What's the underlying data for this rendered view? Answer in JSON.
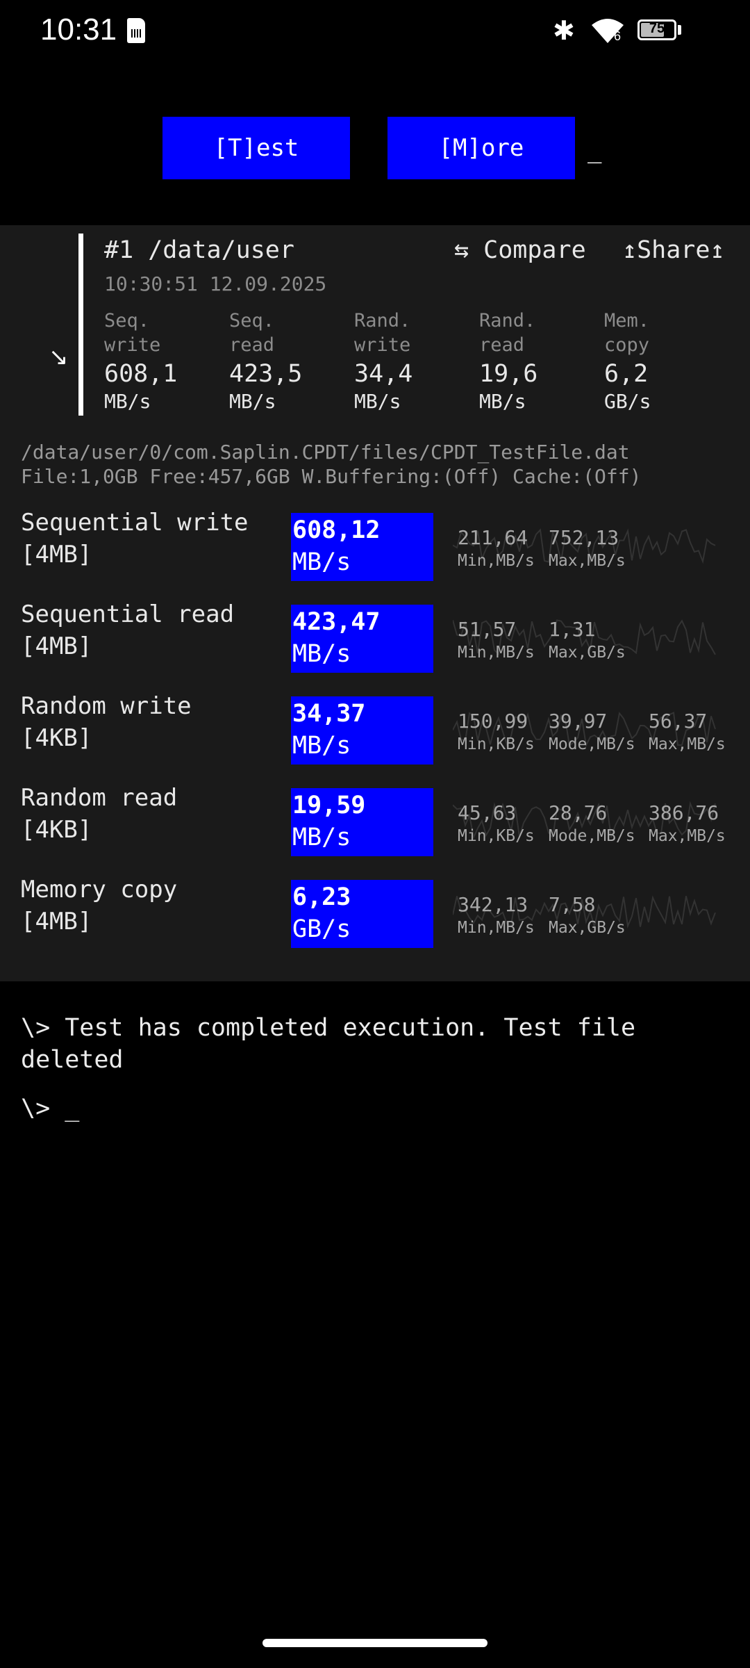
{
  "status_bar": {
    "time": "10:31",
    "bluetooth_icon": "bluetooth-icon",
    "wifi_badge": "6",
    "battery": "75",
    "battery_level_percent": 75
  },
  "buttons": {
    "test": "[T]est",
    "more": "[M]ore",
    "cursor": "_"
  },
  "summary": {
    "title": "#1 /data/user",
    "datetime": "10:30:51 12.09.2025",
    "compare": "⇆ Compare",
    "share": "↥Share↥",
    "expand_icon": "↘",
    "columns": [
      {
        "label": "Seq.\nwrite",
        "value": "608,1",
        "unit": "MB/s"
      },
      {
        "label": "Seq.\nread",
        "value": "423,5",
        "unit": "MB/s"
      },
      {
        "label": "Rand.\nwrite",
        "value": "34,4",
        "unit": "MB/s"
      },
      {
        "label": "Rand.\nread",
        "value": "19,6",
        "unit": "MB/s"
      },
      {
        "label": "Mem.\ncopy",
        "value": "6,2",
        "unit": "GB/s"
      }
    ]
  },
  "file": {
    "path": "/data/user/0/com.Saplin.CPDT/files/CPDT_TestFile.dat",
    "info": "File:1,0GB Free:457,6GB W.Buffering:(Off) Cache:(Off)"
  },
  "tests": [
    {
      "name": "Sequential write\n[4MB]",
      "value": "608,12",
      "unit": "MB/s",
      "stats": [
        {
          "v": "211,64",
          "l": "Min,MB/s"
        },
        {
          "v": "752,13",
          "l": "Max,MB/s"
        }
      ]
    },
    {
      "name": "Sequential read\n[4MB]",
      "value": "423,47",
      "unit": "MB/s",
      "stats": [
        {
          "v": "51,57",
          "l": "Min,MB/s"
        },
        {
          "v": "1,31",
          "l": "Max,GB/s"
        }
      ]
    },
    {
      "name": "Random write\n[4KB]",
      "value": "34,37",
      "unit": "MB/s",
      "stats": [
        {
          "v": "150,99",
          "l": "Min,KB/s"
        },
        {
          "v": "39,97",
          "l": "Mode,MB/s"
        },
        {
          "v": "56,37",
          "l": "Max,MB/s"
        }
      ]
    },
    {
      "name": "Random read\n[4KB]",
      "value": "19,59",
      "unit": "MB/s",
      "stats": [
        {
          "v": "45,63",
          "l": "Min,KB/s"
        },
        {
          "v": "28,76",
          "l": "Mode,MB/s"
        },
        {
          "v": "386,76",
          "l": "Max,MB/s"
        }
      ]
    },
    {
      "name": "Memory copy\n[4MB]",
      "value": "6,23",
      "unit": "GB/s",
      "stats": [
        {
          "v": "342,13",
          "l": "Min,MB/s"
        },
        {
          "v": "7,58",
          "l": "Max,GB/s"
        }
      ]
    }
  ],
  "console": {
    "line1": "\\> Test has completed execution. Test file",
    "line2": "deleted",
    "prompt": "\\> _"
  },
  "colors": {
    "accent": "#0000ff",
    "panel": "#1a1a1a",
    "background": "#000000"
  }
}
